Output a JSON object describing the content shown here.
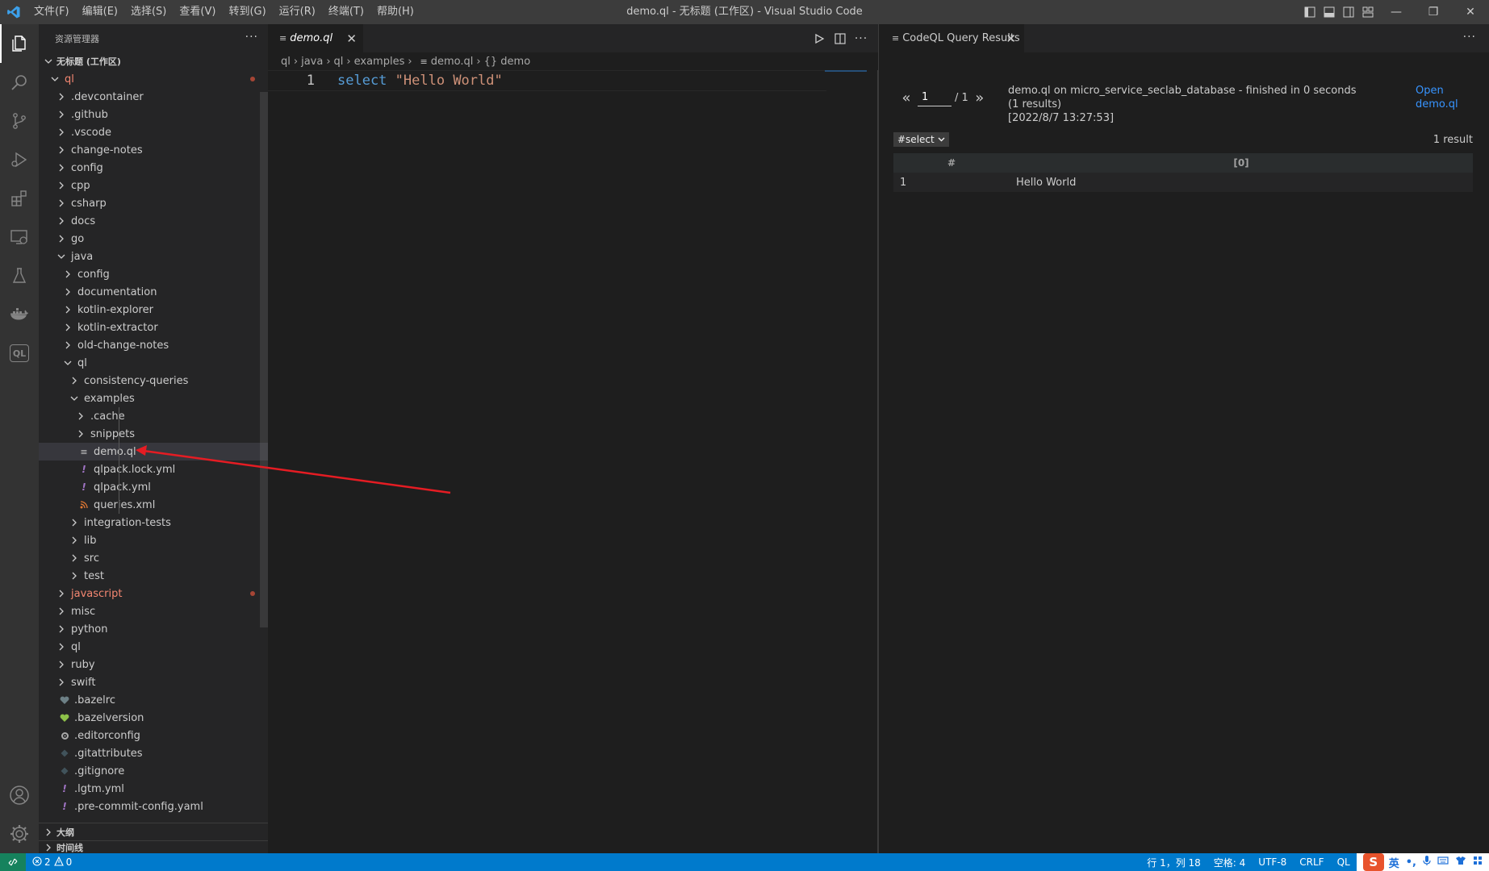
{
  "titlebar": {
    "menu": [
      "文件(F)",
      "编辑(E)",
      "选择(S)",
      "查看(V)",
      "转到(G)",
      "运行(R)",
      "终端(T)",
      "帮助(H)"
    ],
    "title": "demo.ql - 无标题 (工作区) - Visual Studio Code",
    "minimize": "—",
    "restore": "❐",
    "close": "✕"
  },
  "activitybar": {
    "items": [
      "explorer-icon",
      "search-icon",
      "source-control-icon",
      "run-debug-icon",
      "extensions-icon",
      "remote-explorer-icon",
      "testing-icon",
      "docker-icon",
      "codeql-icon"
    ],
    "codeql_label": "QL",
    "bottom": [
      "account-icon",
      "settings-gear-icon"
    ]
  },
  "sidebar": {
    "header": "资源管理器",
    "more": "···",
    "workspace": "无标题 (工作区)",
    "tree": [
      {
        "label": "ql",
        "level": 1,
        "type": "folder",
        "open": true,
        "color": "red",
        "dot": true
      },
      {
        "label": ".devcontainer",
        "level": 2,
        "type": "folder"
      },
      {
        "label": ".github",
        "level": 2,
        "type": "folder"
      },
      {
        "label": ".vscode",
        "level": 2,
        "type": "folder"
      },
      {
        "label": "change-notes",
        "level": 2,
        "type": "folder"
      },
      {
        "label": "config",
        "level": 2,
        "type": "folder"
      },
      {
        "label": "cpp",
        "level": 2,
        "type": "folder"
      },
      {
        "label": "csharp",
        "level": 2,
        "type": "folder"
      },
      {
        "label": "docs",
        "level": 2,
        "type": "folder"
      },
      {
        "label": "go",
        "level": 2,
        "type": "folder"
      },
      {
        "label": "java",
        "level": 2,
        "type": "folder",
        "open": true
      },
      {
        "label": "config",
        "level": 3,
        "type": "folder"
      },
      {
        "label": "documentation",
        "level": 3,
        "type": "folder"
      },
      {
        "label": "kotlin-explorer",
        "level": 3,
        "type": "folder"
      },
      {
        "label": "kotlin-extractor",
        "level": 3,
        "type": "folder"
      },
      {
        "label": "old-change-notes",
        "level": 3,
        "type": "folder"
      },
      {
        "label": "ql",
        "level": 3,
        "type": "folder",
        "open": true
      },
      {
        "label": "consistency-queries",
        "level": 4,
        "type": "folder"
      },
      {
        "label": "examples",
        "level": 4,
        "type": "folder",
        "open": true
      },
      {
        "label": ".cache",
        "level": 5,
        "type": "folder"
      },
      {
        "label": "snippets",
        "level": 5,
        "type": "folder"
      },
      {
        "label": "demo.ql",
        "level": 5,
        "type": "ql",
        "selected": true
      },
      {
        "label": "qlpack.lock.yml",
        "level": 5,
        "type": "yml"
      },
      {
        "label": "qlpack.yml",
        "level": 5,
        "type": "yml"
      },
      {
        "label": "queries.xml",
        "level": 5,
        "type": "xml"
      },
      {
        "label": "integration-tests",
        "level": 4,
        "type": "folder"
      },
      {
        "label": "lib",
        "level": 4,
        "type": "folder"
      },
      {
        "label": "src",
        "level": 4,
        "type": "folder"
      },
      {
        "label": "test",
        "level": 4,
        "type": "folder"
      },
      {
        "label": "javascript",
        "level": 2,
        "type": "folder",
        "color": "red",
        "dot": true
      },
      {
        "label": "misc",
        "level": 2,
        "type": "folder"
      },
      {
        "label": "python",
        "level": 2,
        "type": "folder"
      },
      {
        "label": "ql",
        "level": 2,
        "type": "folder"
      },
      {
        "label": "ruby",
        "level": 2,
        "type": "folder"
      },
      {
        "label": "swift",
        "level": 2,
        "type": "folder"
      },
      {
        "label": ".bazelrc",
        "level": 2,
        "type": "bazel-gray"
      },
      {
        "label": ".bazelversion",
        "level": 2,
        "type": "bazel-green"
      },
      {
        "label": ".editorconfig",
        "level": 2,
        "type": "gear"
      },
      {
        "label": ".gitattributes",
        "level": 2,
        "type": "git"
      },
      {
        "label": ".gitignore",
        "level": 2,
        "type": "git"
      },
      {
        "label": ".lgtm.yml",
        "level": 2,
        "type": "yml"
      },
      {
        "label": ".pre-commit-config.yaml",
        "level": 2,
        "type": "yml"
      }
    ],
    "sections": [
      "大纲",
      "时间线"
    ]
  },
  "editor": {
    "tab_label": "demo.ql",
    "breadcrumb": [
      "ql",
      "java",
      "ql",
      "examples",
      "demo.ql",
      "{} demo"
    ],
    "line_number": "1",
    "code_keyword": "select",
    "code_string": "\"Hello World\""
  },
  "results": {
    "tab_label": "CodeQL Query Results",
    "page_input": "1",
    "page_total": "/ 1",
    "prev": "«",
    "next": "»",
    "meta_line1": "demo.ql on micro_service_seclab_database - finished in 0 seconds (1 results)",
    "meta_line2": "[2022/8/7 13:27:53]",
    "open_link": "Open demo.ql",
    "select_value": "#select",
    "count": "1 result",
    "columns": [
      "#",
      "[0]"
    ],
    "rows": [
      [
        "1",
        "Hello World"
      ]
    ]
  },
  "statusbar": {
    "errors": "2",
    "warnings": "0",
    "position": "行 1，列 18",
    "spaces": "空格: 4",
    "encoding": "UTF-8",
    "eol": "CRLF",
    "language": "QL",
    "ime_logo": "S",
    "ime_lang": "英",
    "ime_punct": "•,"
  },
  "colors": {
    "accent": "#007acc",
    "arrow": "#e51c23",
    "folder_red": "#f48771",
    "link": "#3794ff"
  }
}
